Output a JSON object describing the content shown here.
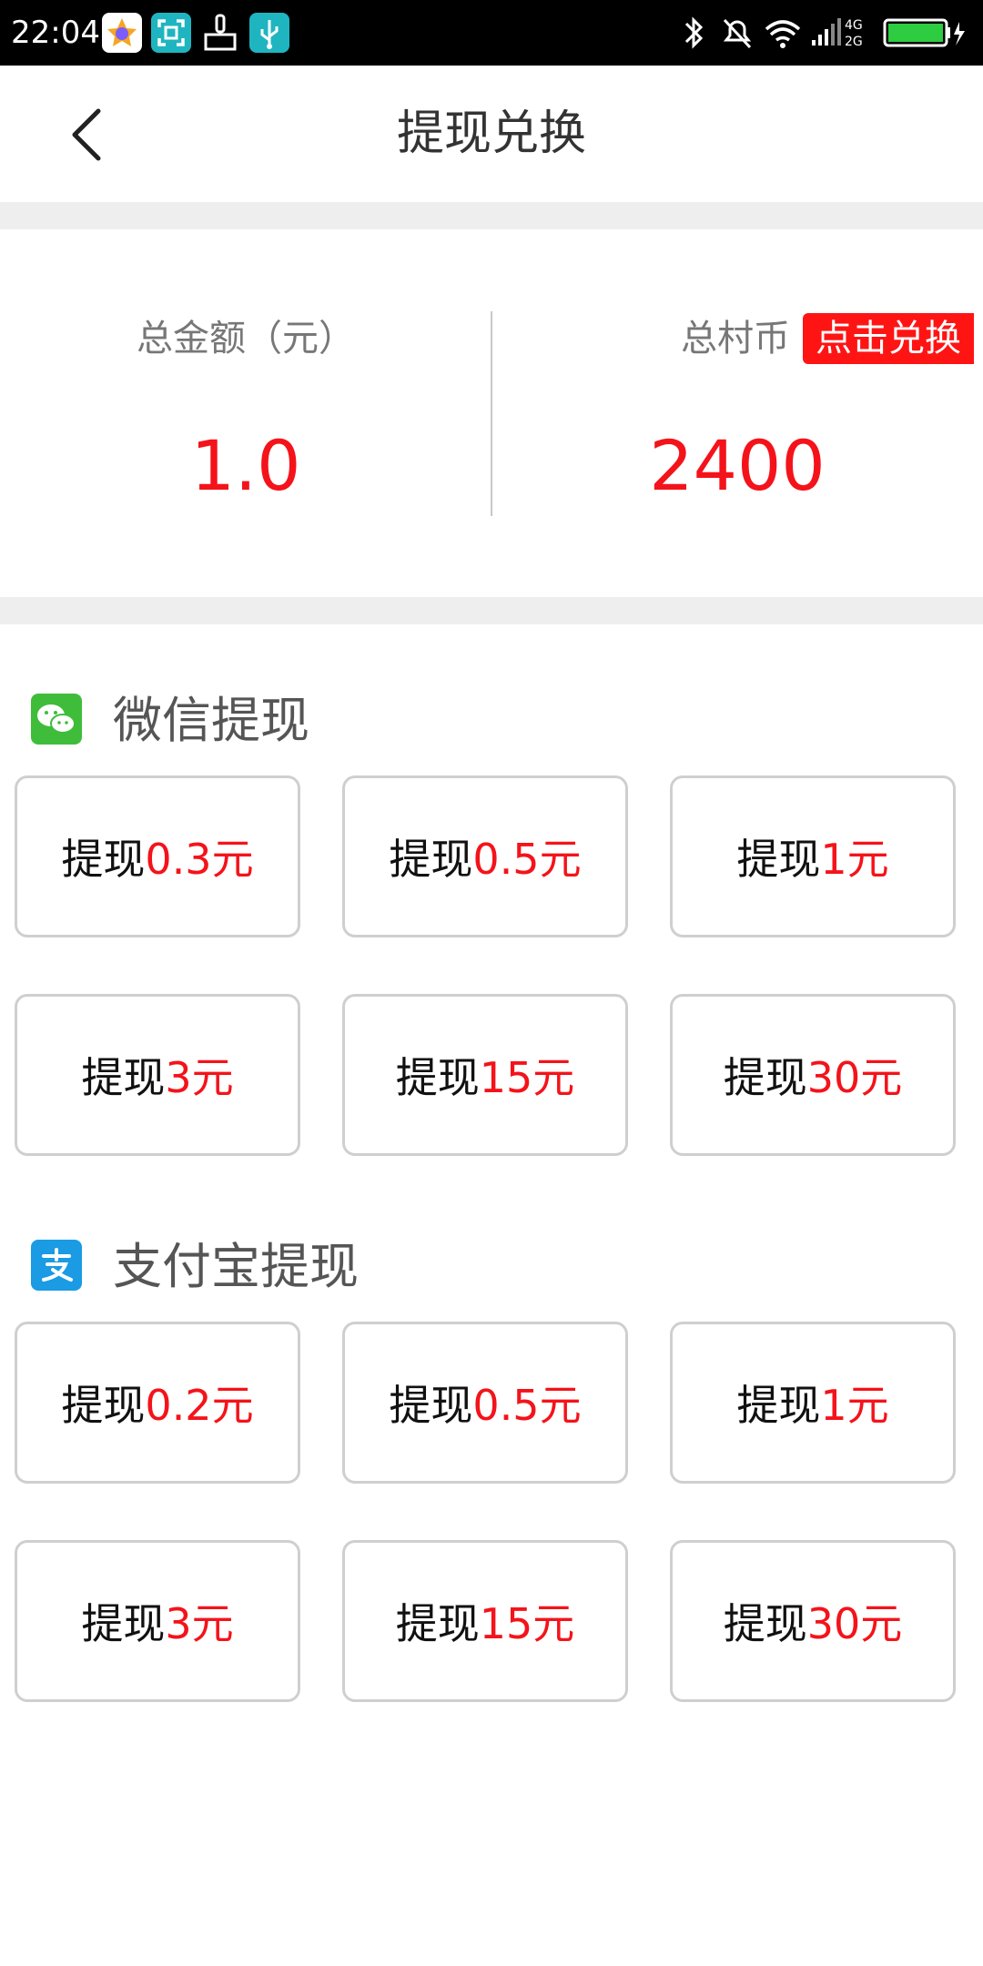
{
  "status_bar": {
    "time": "22:04",
    "network": {
      "top": "4G",
      "bottom": "2G"
    },
    "icons": [
      "app-store-icon",
      "scan-icon",
      "broom-icon",
      "usb-icon",
      "bluetooth-icon",
      "bell-muted-icon",
      "wifi-icon",
      "signal-icon",
      "battery-icon"
    ]
  },
  "header": {
    "title": "提现兑换",
    "back_icon": "chevron-left-icon"
  },
  "summary": {
    "total_amount_label": "总金额（元）",
    "total_amount_value": "1.0",
    "total_coins_label": "总村币",
    "total_coins_value": "2400",
    "exchange_button": "点击兑换"
  },
  "sections": {
    "wechat": {
      "title": "微信提现",
      "icon": "wechat-icon",
      "options": [
        {
          "prefix": "提现",
          "amount": "0.3元"
        },
        {
          "prefix": "提现",
          "amount": "0.5元"
        },
        {
          "prefix": "提现",
          "amount": "1元"
        },
        {
          "prefix": "提现",
          "amount": "3元"
        },
        {
          "prefix": "提现",
          "amount": "15元"
        },
        {
          "prefix": "提现",
          "amount": "30元"
        }
      ]
    },
    "alipay": {
      "title": "支付宝提现",
      "icon": "alipay-icon",
      "options": [
        {
          "prefix": "提现",
          "amount": "0.2元"
        },
        {
          "prefix": "提现",
          "amount": "0.5元"
        },
        {
          "prefix": "提现",
          "amount": "1元"
        },
        {
          "prefix": "提现",
          "amount": "3元"
        },
        {
          "prefix": "提现",
          "amount": "15元"
        },
        {
          "prefix": "提现",
          "amount": "30元"
        }
      ]
    }
  },
  "colors": {
    "accent": "#f4131a",
    "wechat": "#3fbd3a",
    "alipay": "#1a9be3",
    "divider": "#eeeeee"
  }
}
